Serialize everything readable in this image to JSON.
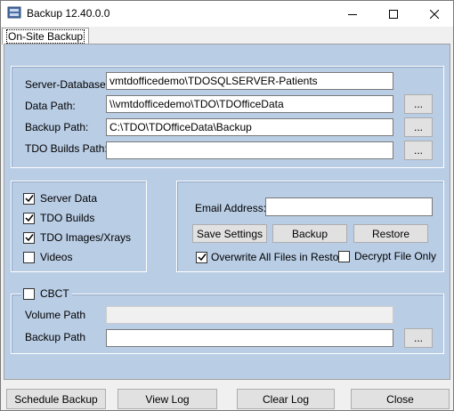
{
  "window": {
    "title": "Backup 12.40.0.0"
  },
  "tabs": [
    {
      "label": "On-Site Backup"
    }
  ],
  "paths": {
    "server_database": {
      "label": "Server-Database:",
      "value": "vmtdofficedemo\\TDOSQLSERVER-Patients"
    },
    "data_path": {
      "label": "Data Path:",
      "value": "\\\\vmtdofficedemo\\TDO\\TDOfficeData",
      "browse": "..."
    },
    "backup_path": {
      "label": "Backup Path:",
      "value": "C:\\TDO\\TDOfficeData\\Backup",
      "browse": "..."
    },
    "builds_path": {
      "label": "TDO Builds Path:",
      "value": "",
      "browse": "..."
    }
  },
  "options": {
    "server_data": {
      "label": "Server Data",
      "checked": true
    },
    "tdo_builds": {
      "label": "TDO Builds",
      "checked": true
    },
    "tdo_images": {
      "label": "TDO Images/Xrays",
      "checked": true
    },
    "videos": {
      "label": "Videos",
      "checked": false
    }
  },
  "email": {
    "label": "Email Address:",
    "value": "",
    "save_settings": "Save Settings",
    "backup": "Backup",
    "restore": "Restore",
    "overwrite": {
      "label": "Overwrite All Files in Restore",
      "checked": true
    },
    "decrypt": {
      "label": "Decrypt File Only",
      "checked": false
    }
  },
  "cbct": {
    "label": "CBCT",
    "checked": false,
    "volume_path": {
      "label": "Volume Path",
      "value": ""
    },
    "backup_path": {
      "label": "Backup Path",
      "value": "",
      "browse": "..."
    }
  },
  "footer": {
    "schedule_backup": "Schedule Backup",
    "view_log": "View Log",
    "clear_log": "Clear Log",
    "close": "Close"
  }
}
